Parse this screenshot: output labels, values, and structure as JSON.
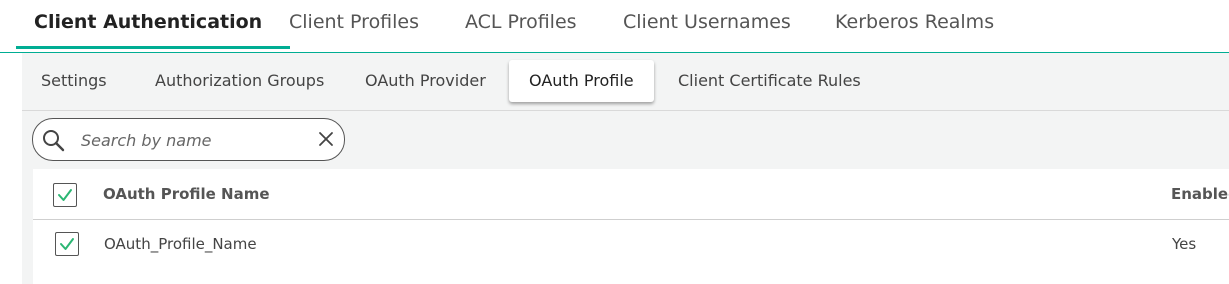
{
  "top_tabs": [
    {
      "label": "Client Authentication",
      "active": true
    },
    {
      "label": "Client Profiles",
      "active": false
    },
    {
      "label": "ACL Profiles",
      "active": false
    },
    {
      "label": "Client Usernames",
      "active": false
    },
    {
      "label": "Kerberos Realms",
      "active": false
    }
  ],
  "sub_tabs": [
    {
      "label": "Settings",
      "active": false
    },
    {
      "label": "Authorization Groups",
      "active": false
    },
    {
      "label": "OAuth Provider",
      "active": false
    },
    {
      "label": "OAuth Profile",
      "active": true
    },
    {
      "label": "Client Certificate Rules",
      "active": false
    }
  ],
  "search": {
    "placeholder": "Search by name",
    "value": "",
    "icon": "search-icon",
    "clear_icon": "close-icon"
  },
  "table": {
    "header_checked": true,
    "columns": [
      "OAuth Profile Name",
      "Enabled"
    ],
    "rows": [
      {
        "checked": true,
        "name": "OAuth_Profile_Name",
        "enabled": "Yes"
      }
    ]
  },
  "colors": {
    "accent": "#00ad93",
    "check": "#2bb673"
  }
}
